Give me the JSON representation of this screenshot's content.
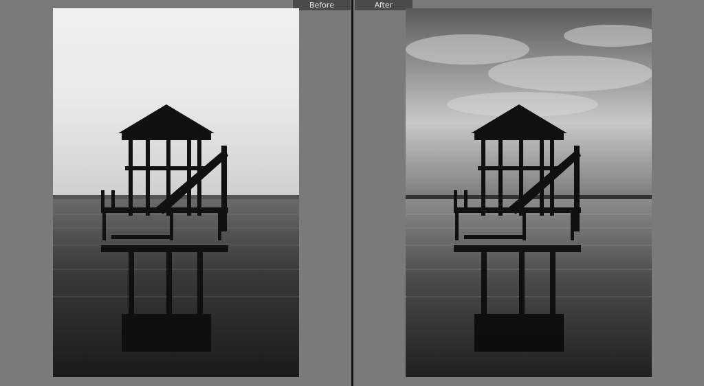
{
  "compare_view": {
    "before_label": "Before",
    "after_label": "After"
  },
  "icons": {
    "before_image": "before-photo",
    "after_image": "after-photo"
  },
  "colors": {
    "background": "#7a7a7a",
    "label_bg": "#4a4a4a",
    "divider": "#141414"
  }
}
